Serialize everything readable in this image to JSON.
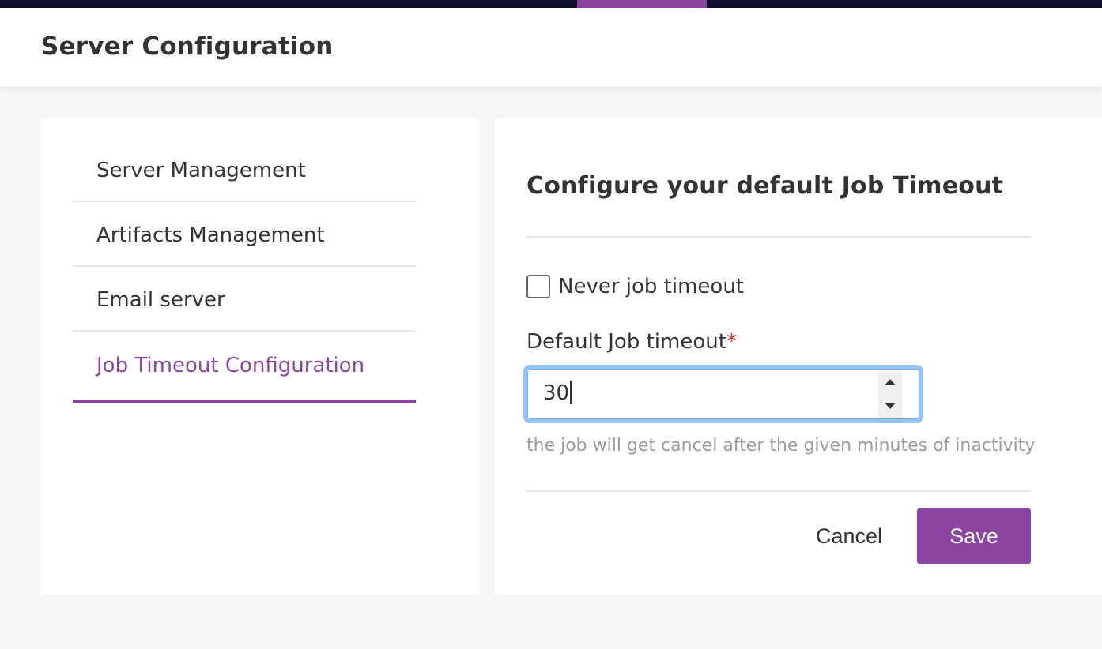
{
  "header": {
    "title": "Server Configuration"
  },
  "sidebar": {
    "items": [
      {
        "label": "Server Management",
        "active": false
      },
      {
        "label": "Artifacts Management",
        "active": false
      },
      {
        "label": "Email server",
        "active": false
      },
      {
        "label": "Job Timeout Configuration",
        "active": true
      }
    ]
  },
  "content": {
    "title": "Configure your default Job Timeout",
    "never_timeout": {
      "label": "Never job timeout",
      "checked": false
    },
    "timeout_field": {
      "label": "Default Job timeout",
      "required_mark": "*",
      "value": "30",
      "help": "the job will get cancel after the given minutes of inactivity"
    },
    "actions": {
      "cancel_label": "Cancel",
      "save_label": "Save"
    }
  },
  "colors": {
    "accent": "#8c44a3",
    "top_bar": "#0f0e2c",
    "focus_ring": "#93c3fb",
    "required": "#d73a3a",
    "help_text": "#9b9b9b",
    "page_background": "#f4f6f7"
  },
  "icons": {
    "stepper_up": "triangle-up-icon",
    "stepper_down": "triangle-down-icon"
  }
}
